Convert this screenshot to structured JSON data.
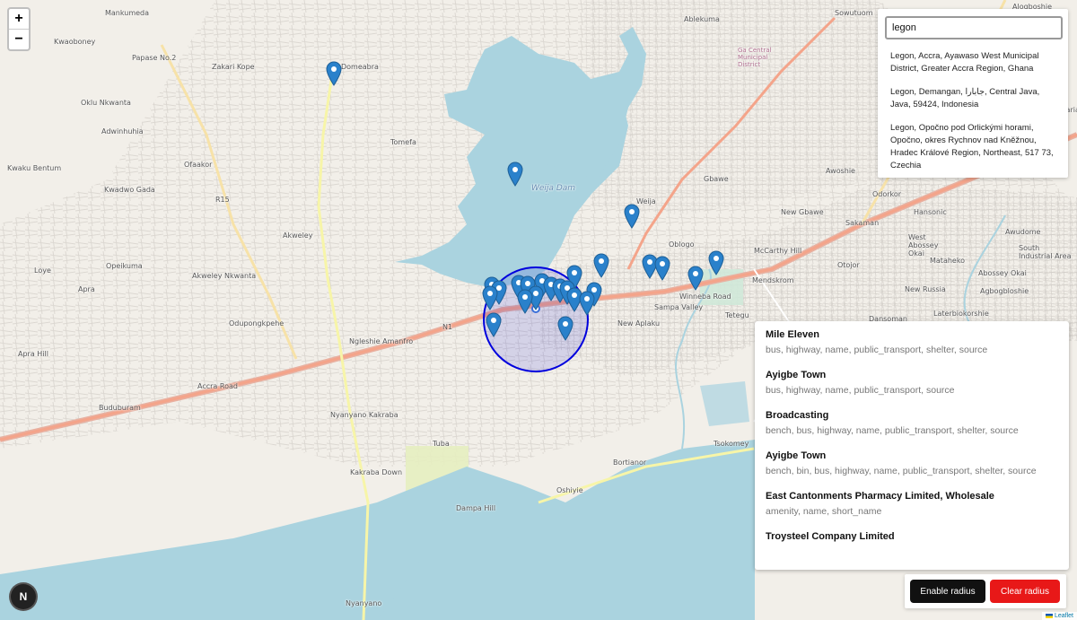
{
  "map": {
    "labels": [
      {
        "text": "Mankumeda"
      },
      {
        "text": "Kwaoboney"
      },
      {
        "text": "Papase No.2"
      },
      {
        "text": "Zakari Kope"
      },
      {
        "text": "Domeabra"
      },
      {
        "text": "Oklu Nkwanta"
      },
      {
        "text": "Adwinhuhia"
      },
      {
        "text": "Ofaakor"
      },
      {
        "text": "Kwaku Bentum"
      },
      {
        "text": "Kwadwo Gada"
      },
      {
        "text": "Tomefa"
      },
      {
        "text": "Akweley"
      },
      {
        "text": "Opeikuma"
      },
      {
        "text": "Akweley Nkwanta"
      },
      {
        "text": "Loye"
      },
      {
        "text": "Apra"
      },
      {
        "text": "Odupongkpehe"
      },
      {
        "text": "Ngleshie Amanfro"
      },
      {
        "text": "Apra Hill"
      },
      {
        "text": "Buduburam"
      },
      {
        "text": "Nyanyano Kakraba"
      },
      {
        "text": "Kakraba Down"
      },
      {
        "text": "Tuba"
      },
      {
        "text": "Oshiyie"
      },
      {
        "text": "Dampa Hill"
      },
      {
        "text": "Nyanyano"
      },
      {
        "text": "Bortianor"
      },
      {
        "text": "Tsokomey"
      },
      {
        "text": "Ablekuma"
      },
      {
        "text": "Sowutuom"
      },
      {
        "text": "Alogboshie"
      },
      {
        "text": "Ga Central Municipal District"
      },
      {
        "text": "Gbawe"
      },
      {
        "text": "Weija"
      },
      {
        "text": "New Gbawe"
      },
      {
        "text": "Oblogo"
      },
      {
        "text": "McCarthy Hill"
      },
      {
        "text": "Otojor"
      },
      {
        "text": "Mendskrom"
      },
      {
        "text": "Sampa Valley"
      },
      {
        "text": "Tetegu"
      },
      {
        "text": "New Aplaku"
      },
      {
        "text": "Awoshie"
      },
      {
        "text": "Odorkor"
      },
      {
        "text": "Sakaman"
      },
      {
        "text": "Hansonic"
      },
      {
        "text": "West Abossey Okai"
      },
      {
        "text": "Awudome"
      },
      {
        "text": "Abossey Okai"
      },
      {
        "text": "Mataheko"
      },
      {
        "text": "New Russia"
      },
      {
        "text": "Agbogbloshie"
      },
      {
        "text": "Dansoman"
      },
      {
        "text": "Laterbiokorshie"
      },
      {
        "text": "South Industrial Area"
      },
      {
        "text": "Santa Maria"
      },
      {
        "text": "Weija Dam"
      },
      {
        "text": "N1"
      },
      {
        "text": "R15"
      },
      {
        "text": "Winneba Road"
      },
      {
        "text": "Accra Road"
      }
    ],
    "marker_color": "#2a81cb",
    "radius_color": "#0000dd"
  },
  "zoom": {
    "in_label": "+",
    "out_label": "−"
  },
  "search": {
    "value": "legon",
    "results": [
      "Legon, Accra, Ayawaso West Municipal District, Greater Accra Region, Ghana",
      "Legon, Demangan, جابارا, Central Java, Java, 59424, Indonesia",
      "Legon, Opočno pod Orlickými horami, Opočno, okres Rychnov nad Kněžnou, Hradec Králové Region, Northeast, 517 73, Czechia"
    ]
  },
  "features": [
    {
      "title": "Mile Eleven",
      "tags": "bus, highway, name, public_transport, shelter, source"
    },
    {
      "title": "Ayigbe Town",
      "tags": "bus, highway, name, public_transport, source"
    },
    {
      "title": "Broadcasting",
      "tags": "bench, bus, highway, name, public_transport, shelter, source"
    },
    {
      "title": "Ayigbe Town",
      "tags": "bench, bin, bus, highway, name, public_transport, shelter, source"
    },
    {
      "title": "East Cantonments Pharmacy Limited, Wholesale",
      "tags": "amenity, name, short_name"
    },
    {
      "title": "Troysteel Company Limited",
      "tags": ""
    }
  ],
  "buttons": {
    "enable_radius": "Enable radius",
    "clear_radius": "Clear radius"
  },
  "logo_letter": "N",
  "attribution": "Leaflet"
}
